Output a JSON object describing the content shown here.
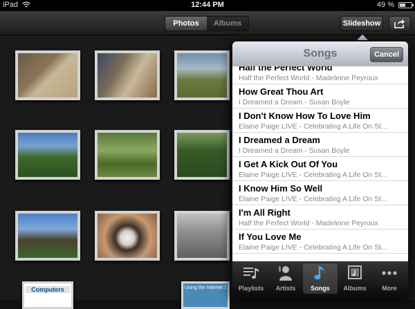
{
  "status": {
    "device": "iPad",
    "time": "12:44 PM",
    "battery": "49 %",
    "battery_level": 0.49
  },
  "toolbar": {
    "tabs": [
      {
        "label": "Photos",
        "selected": true
      },
      {
        "label": "Albums",
        "selected": false
      }
    ],
    "slideshow_label": "Slideshow"
  },
  "popover": {
    "title": "Songs",
    "cancel_label": "Cancel",
    "songs": [
      {
        "title": "Half the Perfect World",
        "subtitle": "Half the Perfect World - Madeleine Peyroux"
      },
      {
        "title": "How Great Thou Art",
        "subtitle": "I Dreamed a Dream - Susan Boyle"
      },
      {
        "title": "I Don't Know How To Love Him",
        "subtitle": "Elaine Paige LIVE - Celebrating A Life On St..."
      },
      {
        "title": "I Dreamed a Dream",
        "subtitle": "I Dreamed a Dream - Susan Boyle"
      },
      {
        "title": "I Get A Kick Out Of You",
        "subtitle": "Elaine Paige LIVE - Celebrating A Life On St..."
      },
      {
        "title": "I Know Him So Well",
        "subtitle": "Elaine Paige LIVE - Celebrating A Life On St..."
      },
      {
        "title": "I'm All Right",
        "subtitle": "Half the Perfect World - Madeleine Peyroux"
      },
      {
        "title": "If You Love Me",
        "subtitle": "Elaine Paige LIVE - Celebrating A Life On St..."
      }
    ],
    "tabs": [
      {
        "label": "Playlists",
        "icon": "playlists-icon",
        "active": false
      },
      {
        "label": "Artists",
        "icon": "artists-icon",
        "active": false
      },
      {
        "label": "Songs",
        "icon": "songs-icon",
        "active": true
      },
      {
        "label": "Albums",
        "icon": "albums-icon",
        "active": false
      },
      {
        "label": "More",
        "icon": "more-icon",
        "active": false
      }
    ]
  },
  "thumbnail_text": [
    "Computers",
    "Using the Internet Safely"
  ],
  "colors": {
    "accent": "#4aa8e8",
    "toolbar": "#2b2b2b",
    "background": "#1a1a1a"
  }
}
